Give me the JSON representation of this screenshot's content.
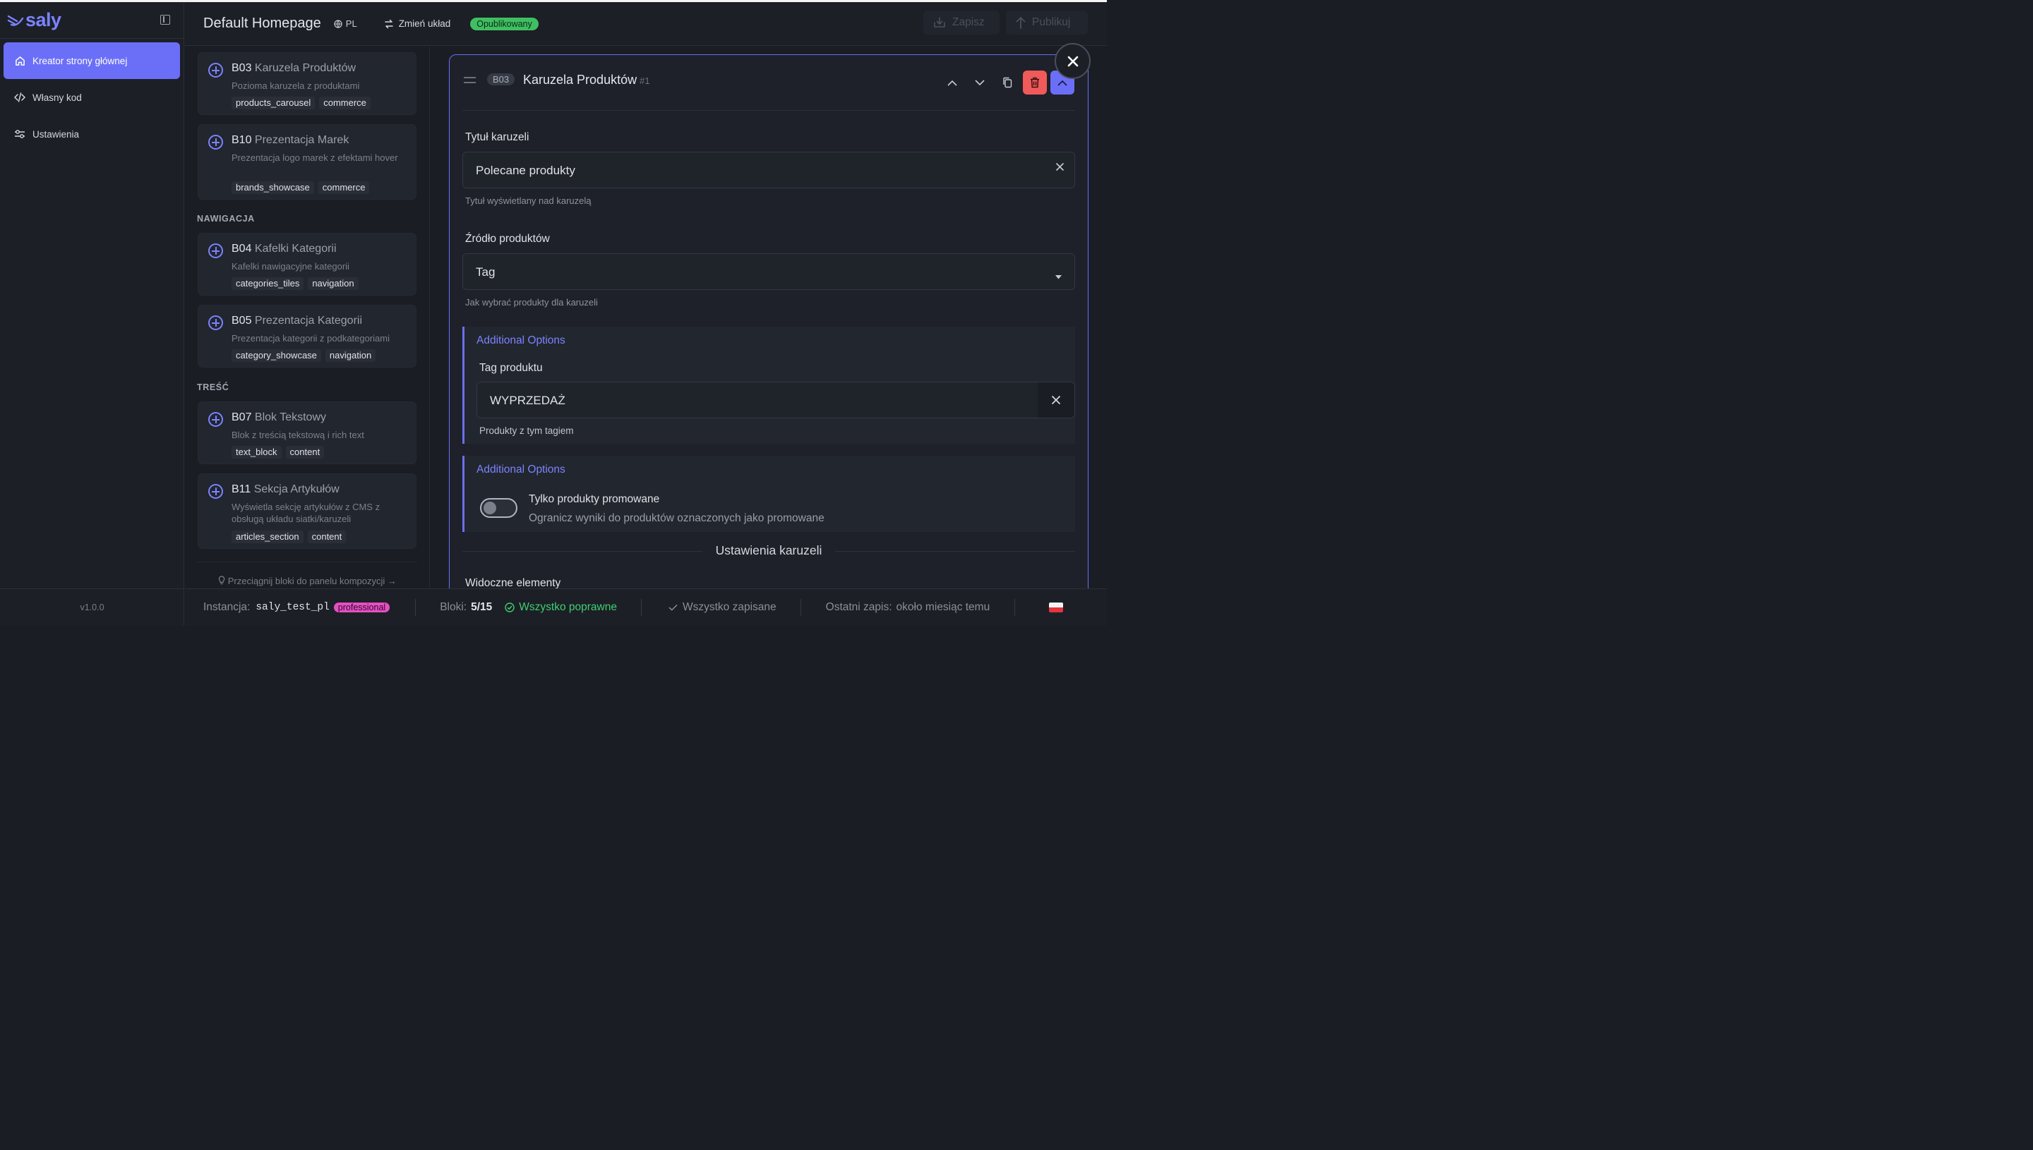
{
  "brand": {
    "name": "saly",
    "accent": "#6b6ff7"
  },
  "sidebar": {
    "items": [
      {
        "label": "Kreator strony głównej",
        "icon": "home-icon",
        "active": true
      },
      {
        "label": "Własny kod",
        "icon": "code-icon",
        "active": false
      },
      {
        "label": "Ustawienia",
        "icon": "sliders-icon",
        "active": false
      }
    ],
    "version": "v1.0.0"
  },
  "header": {
    "title": "Default Homepage",
    "lang": "PL",
    "change_layout": "Zmień układ",
    "status": "Opublikowany",
    "save": "Zapisz",
    "publish": "Publikuj"
  },
  "library": {
    "cards_top": [
      {
        "code": "B03",
        "name": "Karuzela Produktów",
        "desc": "Pozioma karuzela z produktami",
        "tags": [
          "products_carousel",
          "commerce"
        ]
      },
      {
        "code": "B10",
        "name": "Prezentacja Marek",
        "desc": "Prezentacja logo marek z efektami hover",
        "tags": [
          "brands_showcase",
          "commerce"
        ]
      }
    ],
    "section_nav": "NAWIGACJA",
    "cards_nav": [
      {
        "code": "B04",
        "name": "Kafelki Kategorii",
        "desc": "Kafelki nawigacyjne kategorii",
        "tags": [
          "categories_tiles",
          "navigation"
        ]
      },
      {
        "code": "B05",
        "name": "Prezentacja Kategorii",
        "desc": "Prezentacja kategorii z podkategoriami",
        "tags": [
          "category_showcase",
          "navigation"
        ]
      }
    ],
    "section_content": "TREŚĆ",
    "cards_content": [
      {
        "code": "B07",
        "name": "Blok Tekstowy",
        "desc": "Blok z treścią tekstową i rich text",
        "tags": [
          "text_block",
          "content"
        ]
      },
      {
        "code": "B11",
        "name": "Sekcja Artykułów",
        "desc": "Wyświetla sekcję artykułów z CMS z obsługą układu siatki/karuzeli",
        "tags": [
          "articles_section",
          "content"
        ]
      }
    ],
    "drag_hint": "Przeciągnij bloki do panelu kompozycji →"
  },
  "editor": {
    "code": "B03",
    "title": "Karuzela Produktów",
    "index": "#1",
    "title_field": {
      "label": "Tytuł karuzeli",
      "value": "Polecane produkty",
      "hint": "Tytuł wyświetlany nad karuzelą"
    },
    "source_field": {
      "label": "Źródło produktów",
      "value": "Tag",
      "hint": "Jak wybrać produkty dla karuzeli"
    },
    "options1": {
      "title": "Additional Options",
      "label": "Tag produktu",
      "value": "WYPRZEDAŻ",
      "hint": "Produkty z tym tagiem"
    },
    "options2": {
      "title": "Additional Options",
      "toggle_label": "Tylko produkty promowane",
      "toggle_desc": "Ogranicz wyniki do produktów oznaczonych jako promowane",
      "toggle_on": false
    },
    "divider": "Ustawienia karuzeli",
    "visible_label": "Widoczne elementy"
  },
  "footer": {
    "instance_label": "Instancja:",
    "instance": "saly_test_pl",
    "plan": "professional",
    "blocks_label": "Bloki:",
    "blocks": "5/15",
    "valid": "Wszystko poprawne",
    "saved": "Wszystko zapisane",
    "last_save_label": "Ostatni zapis:",
    "last_save": "około miesiąc temu",
    "flag": "poland-flag-icon"
  }
}
